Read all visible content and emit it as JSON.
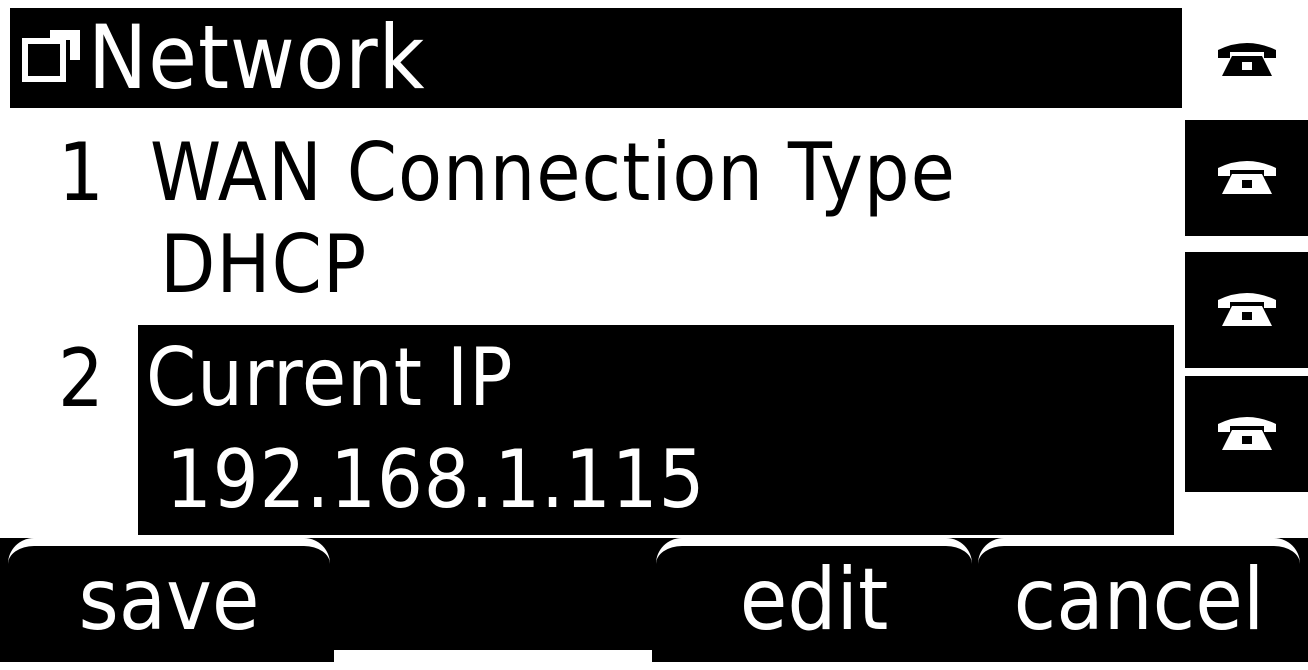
{
  "header": {
    "title": "Network",
    "icon": "return-folder-icon"
  },
  "menu": {
    "items": [
      {
        "number": "1",
        "label": "WAN Connection Type",
        "value": "DHCP",
        "selected": false
      },
      {
        "number": "2",
        "label": "Current IP",
        "value": "192.168.1.115",
        "selected": true
      }
    ]
  },
  "line_keys": {
    "icon": "telephone-icon",
    "count": 4
  },
  "softkeys": {
    "save": "save",
    "empty": "",
    "edit": "edit",
    "cancel": "cancel"
  },
  "colors": {
    "foreground": "#000000",
    "background": "#ffffff"
  }
}
